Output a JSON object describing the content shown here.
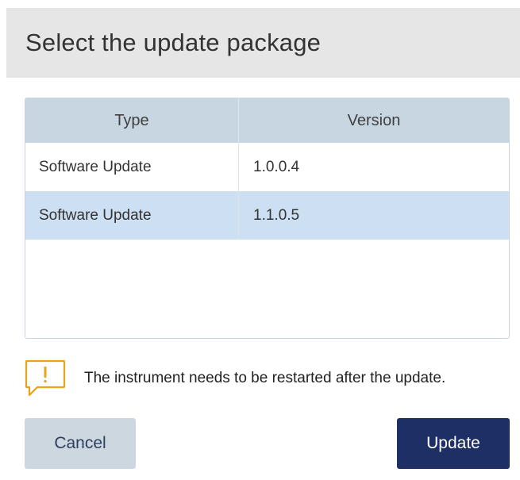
{
  "dialog": {
    "title": "Select the update package"
  },
  "table": {
    "headers": {
      "type": "Type",
      "version": "Version"
    },
    "rows": [
      {
        "type": "Software Update",
        "version": "1.0.0.4",
        "selected": false
      },
      {
        "type": "Software Update",
        "version": "1.1.0.5",
        "selected": true
      }
    ]
  },
  "notice": {
    "icon": "warning-speech-bubble-icon",
    "icon_color": "#e8a317",
    "text": "The instrument needs to be restarted after the update."
  },
  "buttons": {
    "cancel_label": "Cancel",
    "update_label": "Update"
  },
  "colors": {
    "header_bg": "#e6e6e6",
    "table_header_bg": "#c8d6e2",
    "selected_row_bg": "#cddff2",
    "primary_button_bg": "#1e2f66",
    "secondary_button_bg": "#cdd7e0"
  }
}
